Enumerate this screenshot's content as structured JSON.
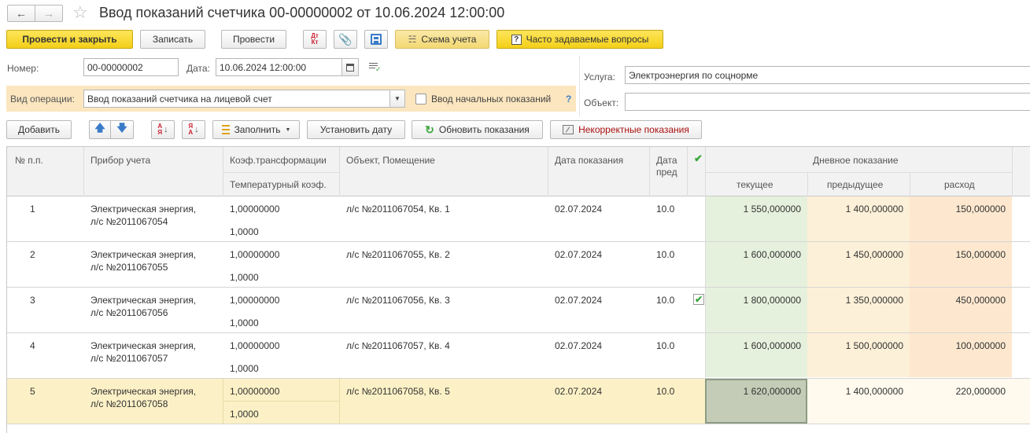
{
  "window": {
    "title": "Ввод показаний счетчика 00-00000002 от 10.06.2024 12:00:00"
  },
  "toolbar": {
    "post_close": "Провести и закрыть",
    "save": "Записать",
    "post": "Провести",
    "dt_kt": "Дт Кт",
    "scheme": "Схема учета",
    "faq": "Часто задаваемые вопросы"
  },
  "form": {
    "number_label": "Номер:",
    "number_value": "00-00000002",
    "date_label": "Дата:",
    "date_value": "10.06.2024 12:00:00",
    "service_label": "Услуга:",
    "service_value": "Электроэнергия по соцнорме",
    "object_label": "Объект:",
    "object_value": "",
    "operation_label": "Вид операции:",
    "operation_value": "Ввод показаний счетчика на лицевой счет",
    "initial_label": "Ввод начальных показаний",
    "help_mark": "?"
  },
  "table_toolbar": {
    "add": "Добавить",
    "fill": "Заполнить",
    "set_date": "Установить дату",
    "refresh": "Обновить показания",
    "incorrect": "Некорректные показания"
  },
  "table": {
    "headers": {
      "num": "№ п.п.",
      "device": "Прибор учета",
      "coef": "Коэф.трансформации",
      "temp": "Температурный коэф.",
      "object": "Объект, Помещение",
      "date": "Дата показания",
      "date_prev": "Дата пред",
      "day": "Дневное показание",
      "current": "текущее",
      "previous": "предыдущее",
      "consumption": "расход"
    },
    "rows": [
      {
        "n": "1",
        "device1": "Электрическая энергия,",
        "device2": "л/с №2011067054",
        "coef": "1,00000000",
        "temp": "1,0000",
        "object": "л/с №2011067054, Кв. 1",
        "date": "02.07.2024",
        "date_prev": "10.0",
        "checked": false,
        "current": "1 550,000000",
        "previous": "1 400,000000",
        "consumption": "150,000000"
      },
      {
        "n": "2",
        "device1": "Электрическая энергия,",
        "device2": "л/с №2011067055",
        "coef": "1,00000000",
        "temp": "1,0000",
        "object": "л/с №2011067055, Кв. 2",
        "date": "02.07.2024",
        "date_prev": "10.0",
        "checked": false,
        "current": "1 600,000000",
        "previous": "1 450,000000",
        "consumption": "150,000000"
      },
      {
        "n": "3",
        "device1": "Электрическая энергия,",
        "device2": "л/с №2011067056",
        "coef": "1,00000000",
        "temp": "1,0000",
        "object": "л/с №2011067056, Кв. 3",
        "date": "02.07.2024",
        "date_prev": "10.0",
        "checked": true,
        "current": "1 800,000000",
        "previous": "1 350,000000",
        "consumption": "450,000000"
      },
      {
        "n": "4",
        "device1": "Электрическая энергия,",
        "device2": "л/с №2011067057",
        "coef": "1,00000000",
        "temp": "1,0000",
        "object": "л/с №2011067057, Кв. 4",
        "date": "02.07.2024",
        "date_prev": "10.0",
        "checked": false,
        "current": "1 600,000000",
        "previous": "1 500,000000",
        "consumption": "100,000000"
      },
      {
        "n": "5",
        "device1": "Электрическая энергия,",
        "device2": "л/с №2011067058",
        "coef": "1,00000000",
        "temp": "1,0000",
        "object": "л/с №2011067058, Кв. 5",
        "date": "02.07.2024",
        "date_prev": "10.0",
        "checked": false,
        "current": "1 620,000000",
        "previous": "1 400,000000",
        "consumption": "220,000000"
      }
    ]
  },
  "colors": {
    "accent_yellow": "#f3cf19",
    "selected_row": "#fcf1c6",
    "current_col": "#e6f1dd",
    "check_green": "#3aa53a"
  }
}
